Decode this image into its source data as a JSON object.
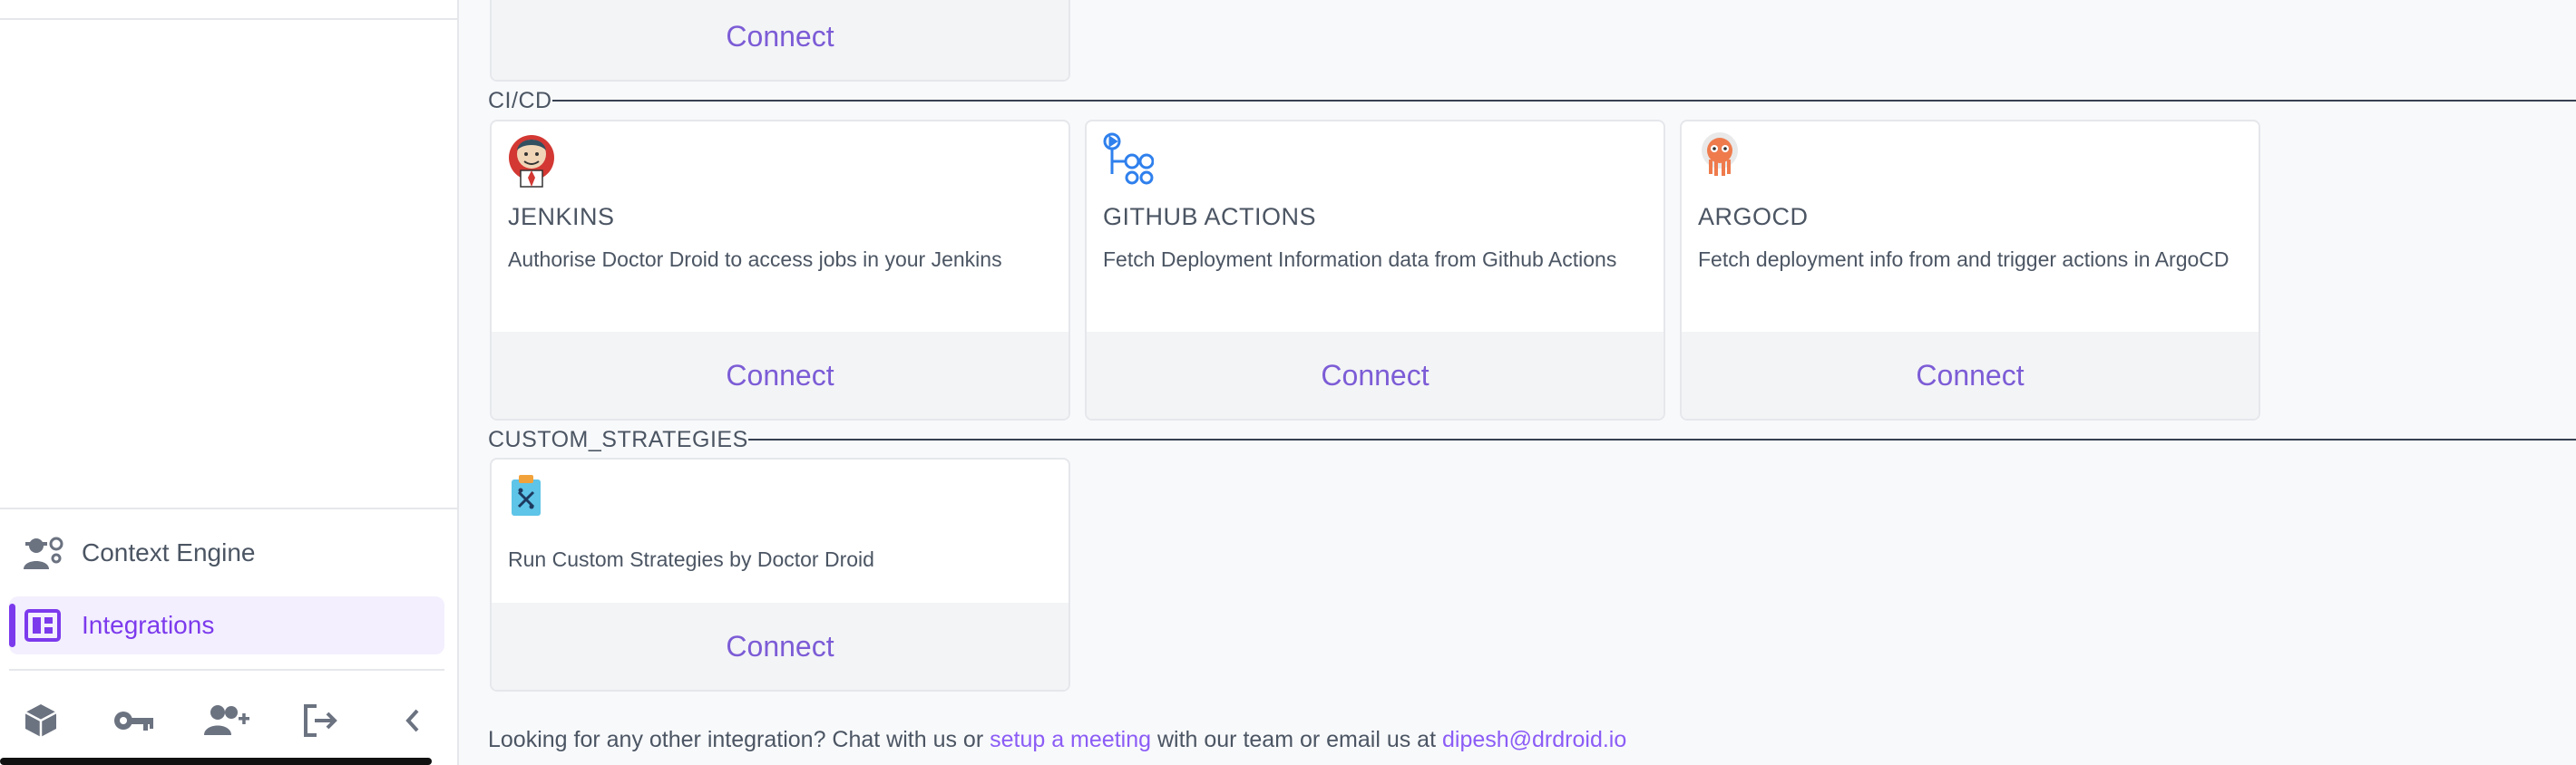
{
  "sidebar": {
    "items": [
      {
        "label": "Context Engine",
        "icon": "user-gear-icon"
      },
      {
        "label": "Integrations",
        "icon": "integrations-grid-icon",
        "active": true
      }
    ],
    "bottom_icons": [
      "cube-icon",
      "key-icon",
      "add-user-icon",
      "logout-icon",
      "collapse-chevron-icon"
    ]
  },
  "top_card": {
    "connect_label": "Connect"
  },
  "sections": {
    "cicd": {
      "title": "CI/CD",
      "cards": [
        {
          "name": "JENKINS",
          "description": "Authorise Doctor Droid to access jobs in your Jenkins",
          "connect_label": "Connect",
          "icon": "jenkins-logo"
        },
        {
          "name": "GITHUB ACTIONS",
          "description": "Fetch Deployment Information data from Github Actions",
          "connect_label": "Connect",
          "icon": "github-actions-logo"
        },
        {
          "name": "ARGOCD",
          "description": "Fetch deployment info from and trigger actions in ArgoCD",
          "connect_label": "Connect",
          "icon": "argocd-logo"
        }
      ]
    },
    "custom": {
      "title": "CUSTOM_STRATEGIES",
      "cards": [
        {
          "name": "",
          "description": "Run Custom Strategies by Doctor Droid",
          "connect_label": "Connect",
          "icon": "clipboard-strategy-icon"
        }
      ]
    }
  },
  "footer": {
    "text_before": "Looking for any other integration? Chat with us or ",
    "meeting_link": "setup a meeting",
    "text_middle": " with our team or email us at ",
    "email_link": "dipesh@drdroid.io"
  },
  "colors": {
    "accent": "#7c3aed",
    "connect_text": "#7c5cd6",
    "connect_bg": "#f3f4f6"
  }
}
